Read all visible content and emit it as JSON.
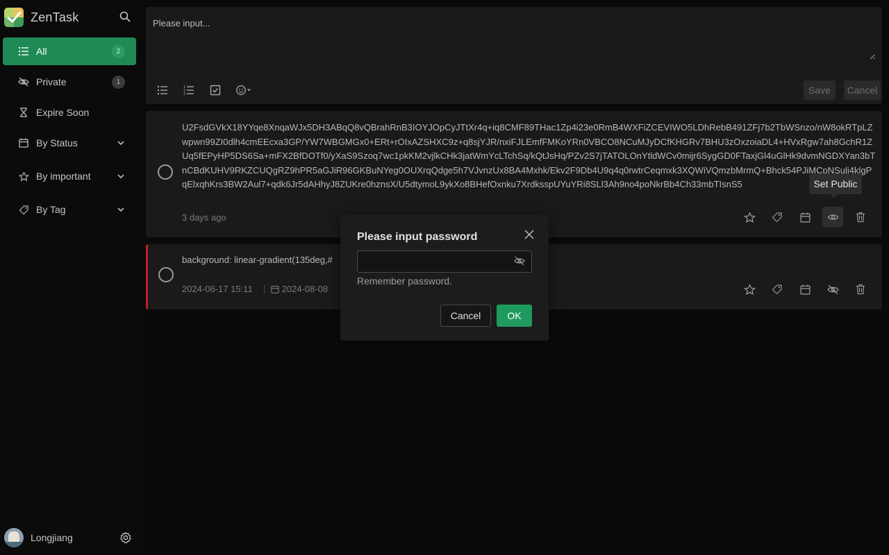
{
  "app": {
    "name": "ZenTask",
    "brand_colors": [
      "#b7d66a",
      "#e9c35d",
      "#6fb46a",
      "#3f9a55"
    ]
  },
  "sidebar": {
    "items": [
      {
        "label": "All",
        "icon": "list-icon",
        "count": "2",
        "active": true
      },
      {
        "label": "Private",
        "icon": "eye-off-icon",
        "count": "1"
      },
      {
        "label": "Expire Soon",
        "icon": "hourglass-icon"
      },
      {
        "label": "By Status",
        "icon": "calendar-icon",
        "expandable": true
      },
      {
        "label": "By important",
        "icon": "star-icon",
        "expandable": true
      },
      {
        "label": "By Tag",
        "icon": "tag-icon",
        "expandable": true
      }
    ],
    "active_color": "#1f8a55"
  },
  "user": {
    "name": "Longjiang"
  },
  "editor": {
    "placeholder": "Please input...",
    "save_label": "Save",
    "cancel_label": "Cancel",
    "tools": [
      "bullet-list-icon",
      "numbered-list-icon",
      "checkbox-icon",
      "emoji-icon"
    ]
  },
  "notes": [
    {
      "text": "U2FsdGVkX18YYqe8XnqaWJx5DH3ABqQ8vQBrahRnB3IOYJOpCyJTtXr4q+iq8CMF89THac1Zp4i23e0RmB4WXFiZCEVIWO5LDhRebB491ZFj7b2TbWSnzo/nW8okRTpLZwpwn99ZI0dlh4cmEEcxa3GP/YW7WBGMGx0+ERt+rOIxAZSHXC9z+q8sjYJR/nxiFJLEmfFMKoYRn0VBCO8NCuMJyDCfKHGRv7BHU3zOxzoiaDL4+HVxRgw7ah8GchR1ZUq5fEPyHP5DS6Sa+mFX2BfDOTf0/yXaS9Szoq7wc1pkKM2vjlkCHk3jatWmYcLTchSq/kQtJsHq/PZv2S7jTATOLOnYtldWCv0mijr6SygGD0FTaxjGl4uGlHk9dvmNGDXYan3bTnCBdKUHV9RKZCUQgRZ9hPR5aGJiR96GKBuNYeg0OUXrqQdge5h7VJvnzUx8BA4Mxhk/Ekv2F9Db4U9q4q0rwtrCeqmxk3XQWiVQmzbMrmQ+Bhck54PJiMCpNSuli4klgPqElxqhKrs3BW2Aul7+qdk6Jr5dAHhyJ8ZUKre0hznsX/U5dtymoL9ykXo8BHefOxnku7XrdksspUYuYRi8SLl3Ah9no4poNkrBb4Ch33mbTIsnS5",
      "time": "3 days ago"
    },
    {
      "text": "background: linear-gradient(135deg,#",
      "created": "2024-06-17 15:11",
      "due": "2024-08-08",
      "important_color": "#c0202a"
    }
  ],
  "tooltip": {
    "text": "Set Public"
  },
  "modal": {
    "title": "Please input password",
    "password_value": "",
    "remember_label": "Remember password.",
    "cancel_label": "Cancel",
    "ok_label": "OK",
    "ok_color": "#1f9a5e"
  }
}
